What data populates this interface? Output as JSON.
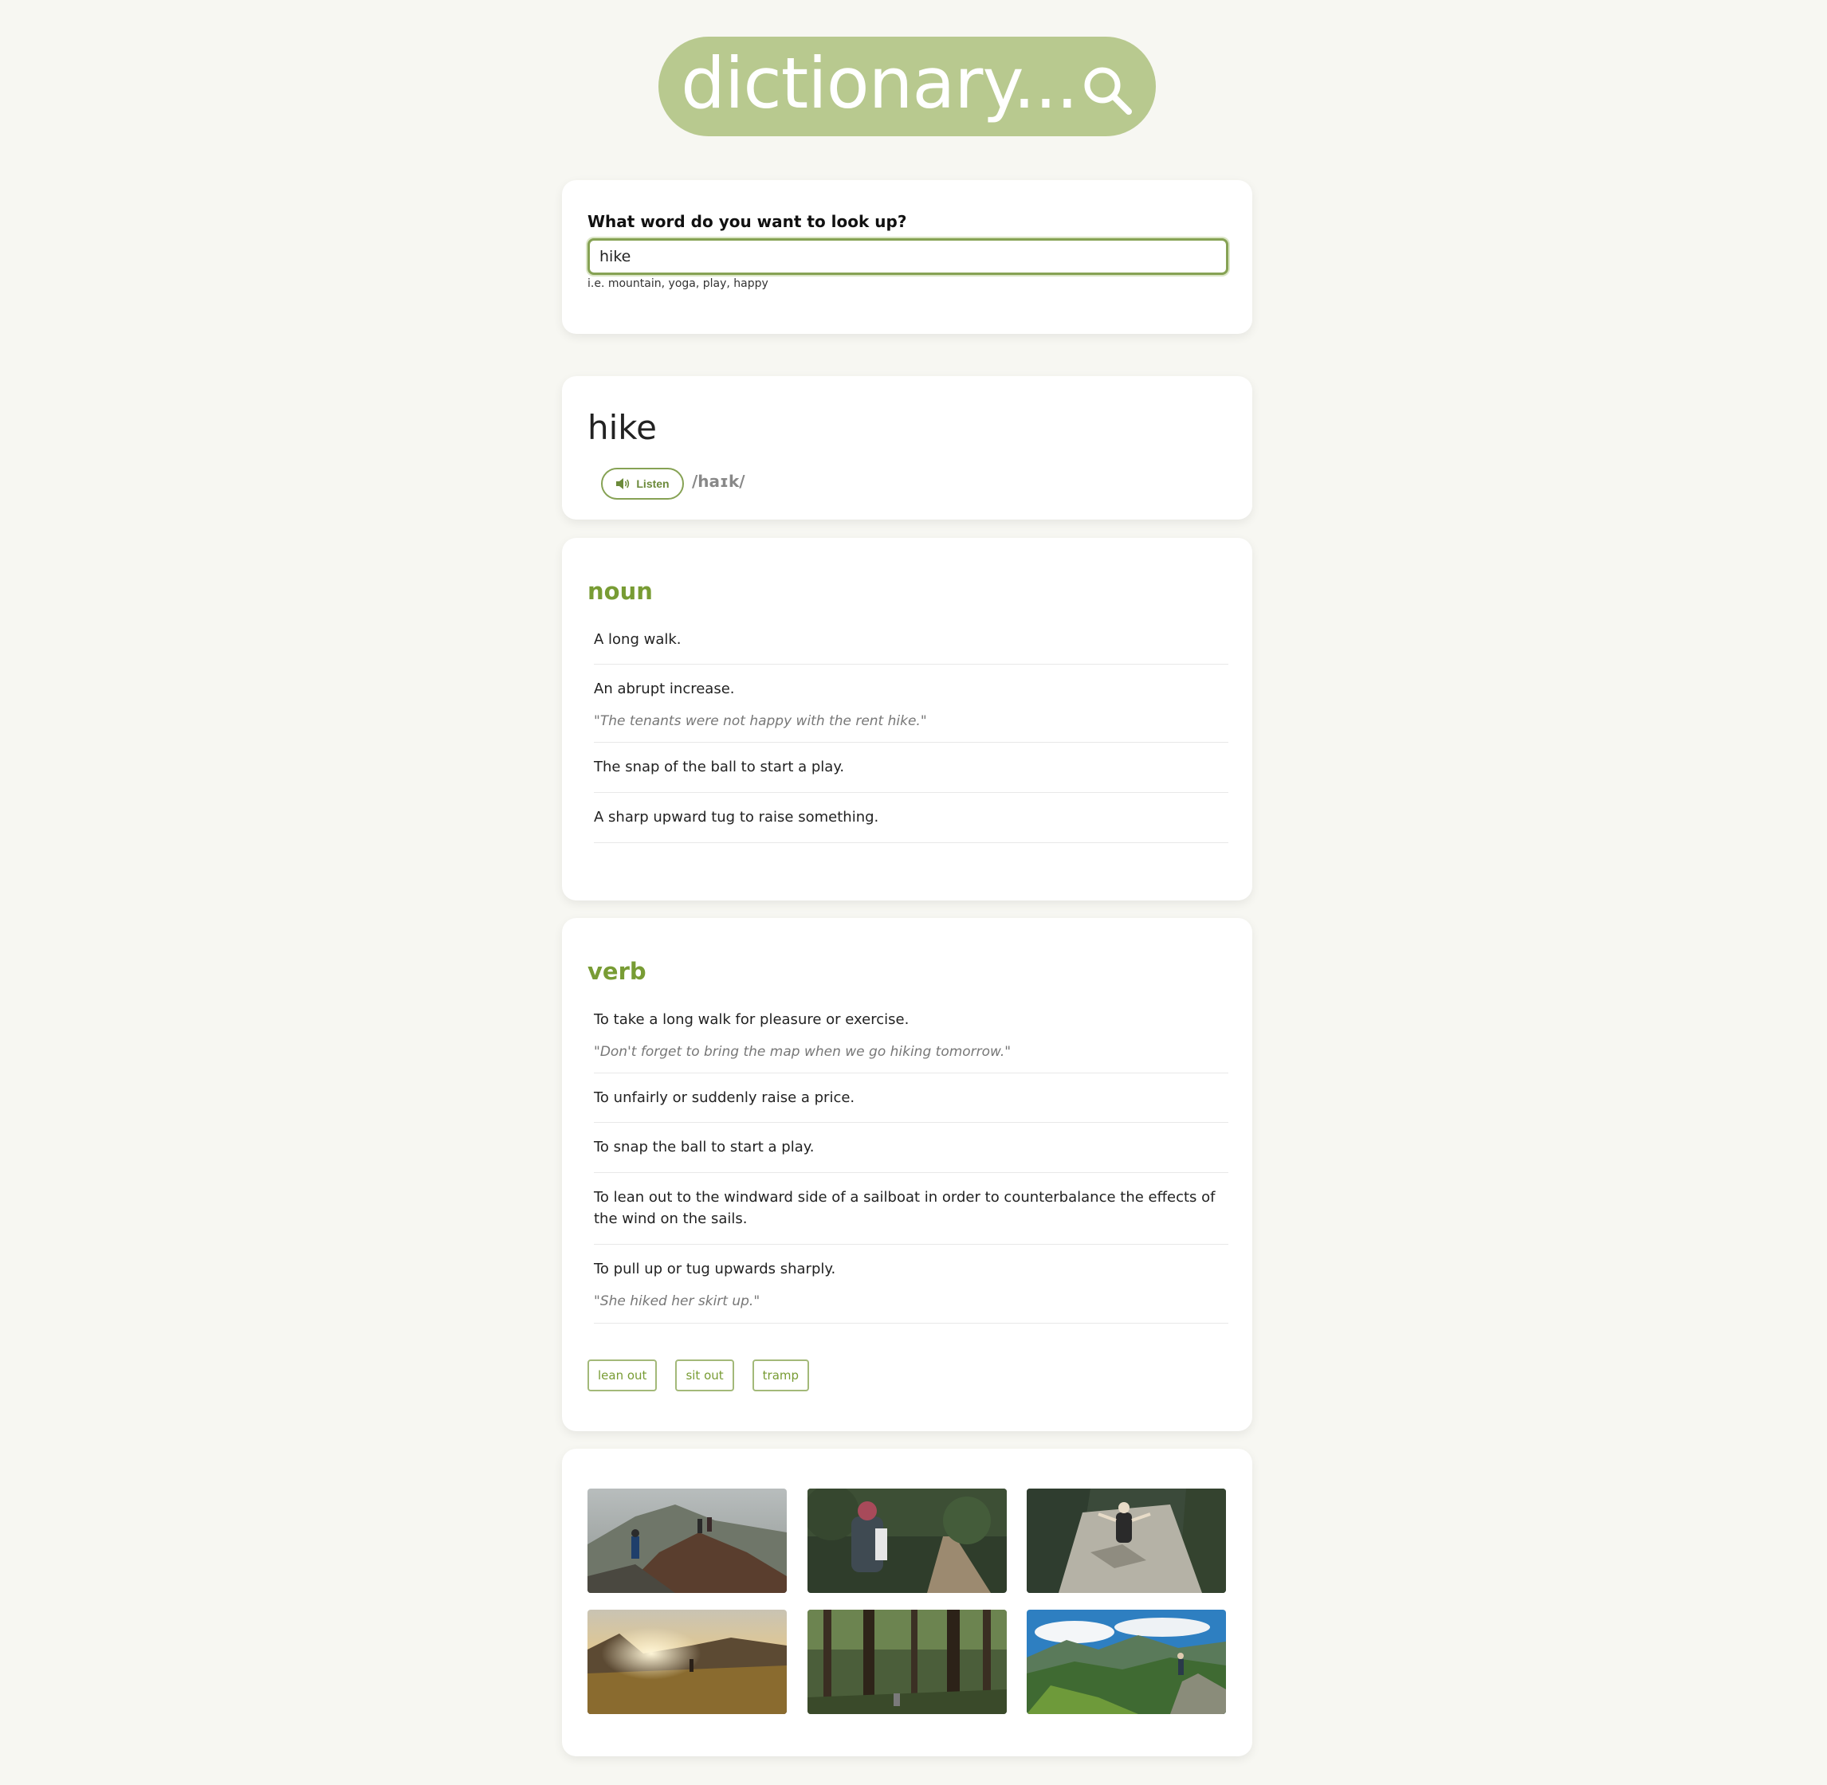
{
  "logo": {
    "text": "dictionary...",
    "icon": "search-icon"
  },
  "search": {
    "label": "What word do you want to look up?",
    "value": "hike",
    "hint": "i.e. mountain, yoga, play, happy"
  },
  "word": {
    "title": "hike",
    "listen_label": "Listen",
    "listen_icon": "speaker-icon",
    "phonetic": "/haɪk/"
  },
  "meanings": [
    {
      "part_of_speech": "noun",
      "definitions": [
        {
          "text": "A long walk.",
          "example": ""
        },
        {
          "text": "An abrupt increase.",
          "example": "\"The tenants were not happy with the rent hike.\""
        },
        {
          "text": "The snap of the ball to start a play.",
          "example": ""
        },
        {
          "text": "A sharp upward tug to raise something.",
          "example": ""
        }
      ]
    },
    {
      "part_of_speech": "verb",
      "definitions": [
        {
          "text": "To take a long walk for pleasure or exercise.",
          "example": "\"Don't forget to bring the map when we go hiking tomorrow.\""
        },
        {
          "text": "To unfairly or suddenly raise a price.",
          "example": ""
        },
        {
          "text": "To snap the ball to start a play.",
          "example": ""
        },
        {
          "text": "To lean out to the windward side of a sailboat in order to counterbalance the effects of the wind on the sails.",
          "example": ""
        },
        {
          "text": "To pull up or tug upwards sharply.",
          "example": "\"She hiked her skirt up.\""
        }
      ],
      "synonyms": [
        "lean out",
        "sit out",
        "tramp"
      ]
    }
  ],
  "photos": [
    {
      "name": "photo-hikers-mountain-ridge"
    },
    {
      "name": "photo-hiker-forest-trail"
    },
    {
      "name": "photo-hiker-rocky-path"
    },
    {
      "name": "photo-sunset-meadow-hiker"
    },
    {
      "name": "photo-pine-forest"
    },
    {
      "name": "photo-alpine-valley-hiker"
    }
  ],
  "colors": {
    "accent": "#789c34",
    "logo_bg": "#b8c98f",
    "page_bg": "#f7f7f2",
    "input_border": "#86a254"
  }
}
